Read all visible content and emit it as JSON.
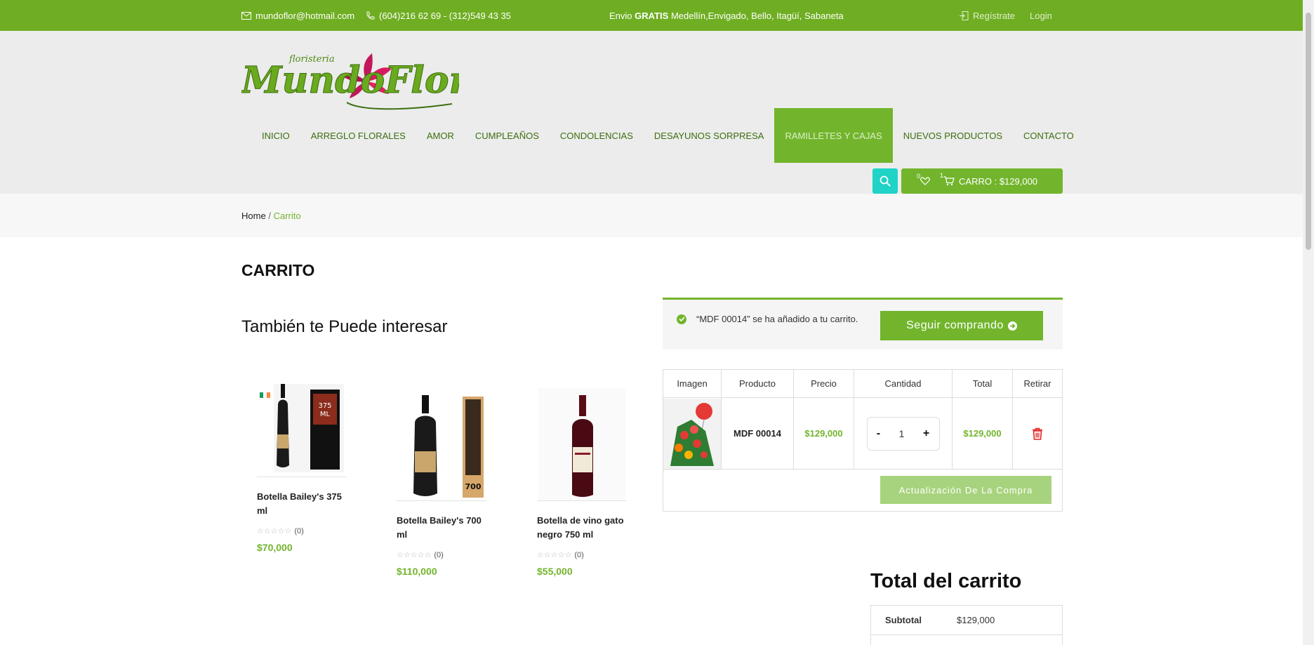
{
  "topbar": {
    "email": "mundoflor@hotmail.com",
    "phone": "(604)216 62 69 - (312)549 43 35",
    "shipping_prefix": "Envio",
    "shipping_bold": "GRATIS",
    "shipping_rest": "Medellín,Envigado, Bello, Itagüí, Sabaneta",
    "register": "Regístrate",
    "login": "Login"
  },
  "logo": {
    "small": "floristeria",
    "main": "MundoFlor"
  },
  "nav": {
    "items": [
      "INICIO",
      "ARREGLO FLORALES",
      "AMOR",
      "CUMPLEAÑOS",
      "CONDOLENCIAS",
      "DESAYUNOS SORPRESA",
      "RAMILLETES Y CAJAS",
      "NUEVOS PRODUCTOS",
      "CONTACTO"
    ],
    "active_index": 6
  },
  "cart_button": {
    "wishlist_count": "0",
    "cart_count": "1",
    "label": "CARRO : $129,000"
  },
  "breadcrumb": {
    "home": "Home",
    "sep": "/",
    "current": "Carrito"
  },
  "page_title": "CARRITO",
  "also_title": "También te Puede interesar",
  "products": [
    {
      "name": "Botella Bailey's 375 ml",
      "stars": "☆☆☆☆☆",
      "reviews": "(0)",
      "price": "$70,000"
    },
    {
      "name": "Botella Bailey's 700 ml",
      "stars": "☆☆☆☆☆",
      "reviews": "(0)",
      "price": "$110,000"
    },
    {
      "name": "Botella de vino gato negro 750 ml",
      "stars": "☆☆☆☆☆",
      "reviews": "(0)",
      "price": "$55,000"
    }
  ],
  "notice": {
    "message": "“MDF 00014” se ha añadido a tu carrito.",
    "button": "Seguir comprando"
  },
  "cart_table": {
    "headers": [
      "Imagen",
      "Producto",
      "Precio",
      "Cantidad",
      "Total",
      "Retirar"
    ],
    "item": {
      "product": "MDF 00014",
      "price": "$129,000",
      "qty_minus": "-",
      "qty": "1",
      "qty_plus": "+",
      "total": "$129,000"
    },
    "update_button": "Actualización De La Compra"
  },
  "totals": {
    "title": "Total del carrito",
    "subtotal_label": "Subtotal",
    "subtotal_value": "$129,000"
  },
  "colors": {
    "brand_green": "#72b52c",
    "topbar_green": "#6fae22",
    "search_teal": "#1fd3c6",
    "remove_red": "#e02424"
  }
}
